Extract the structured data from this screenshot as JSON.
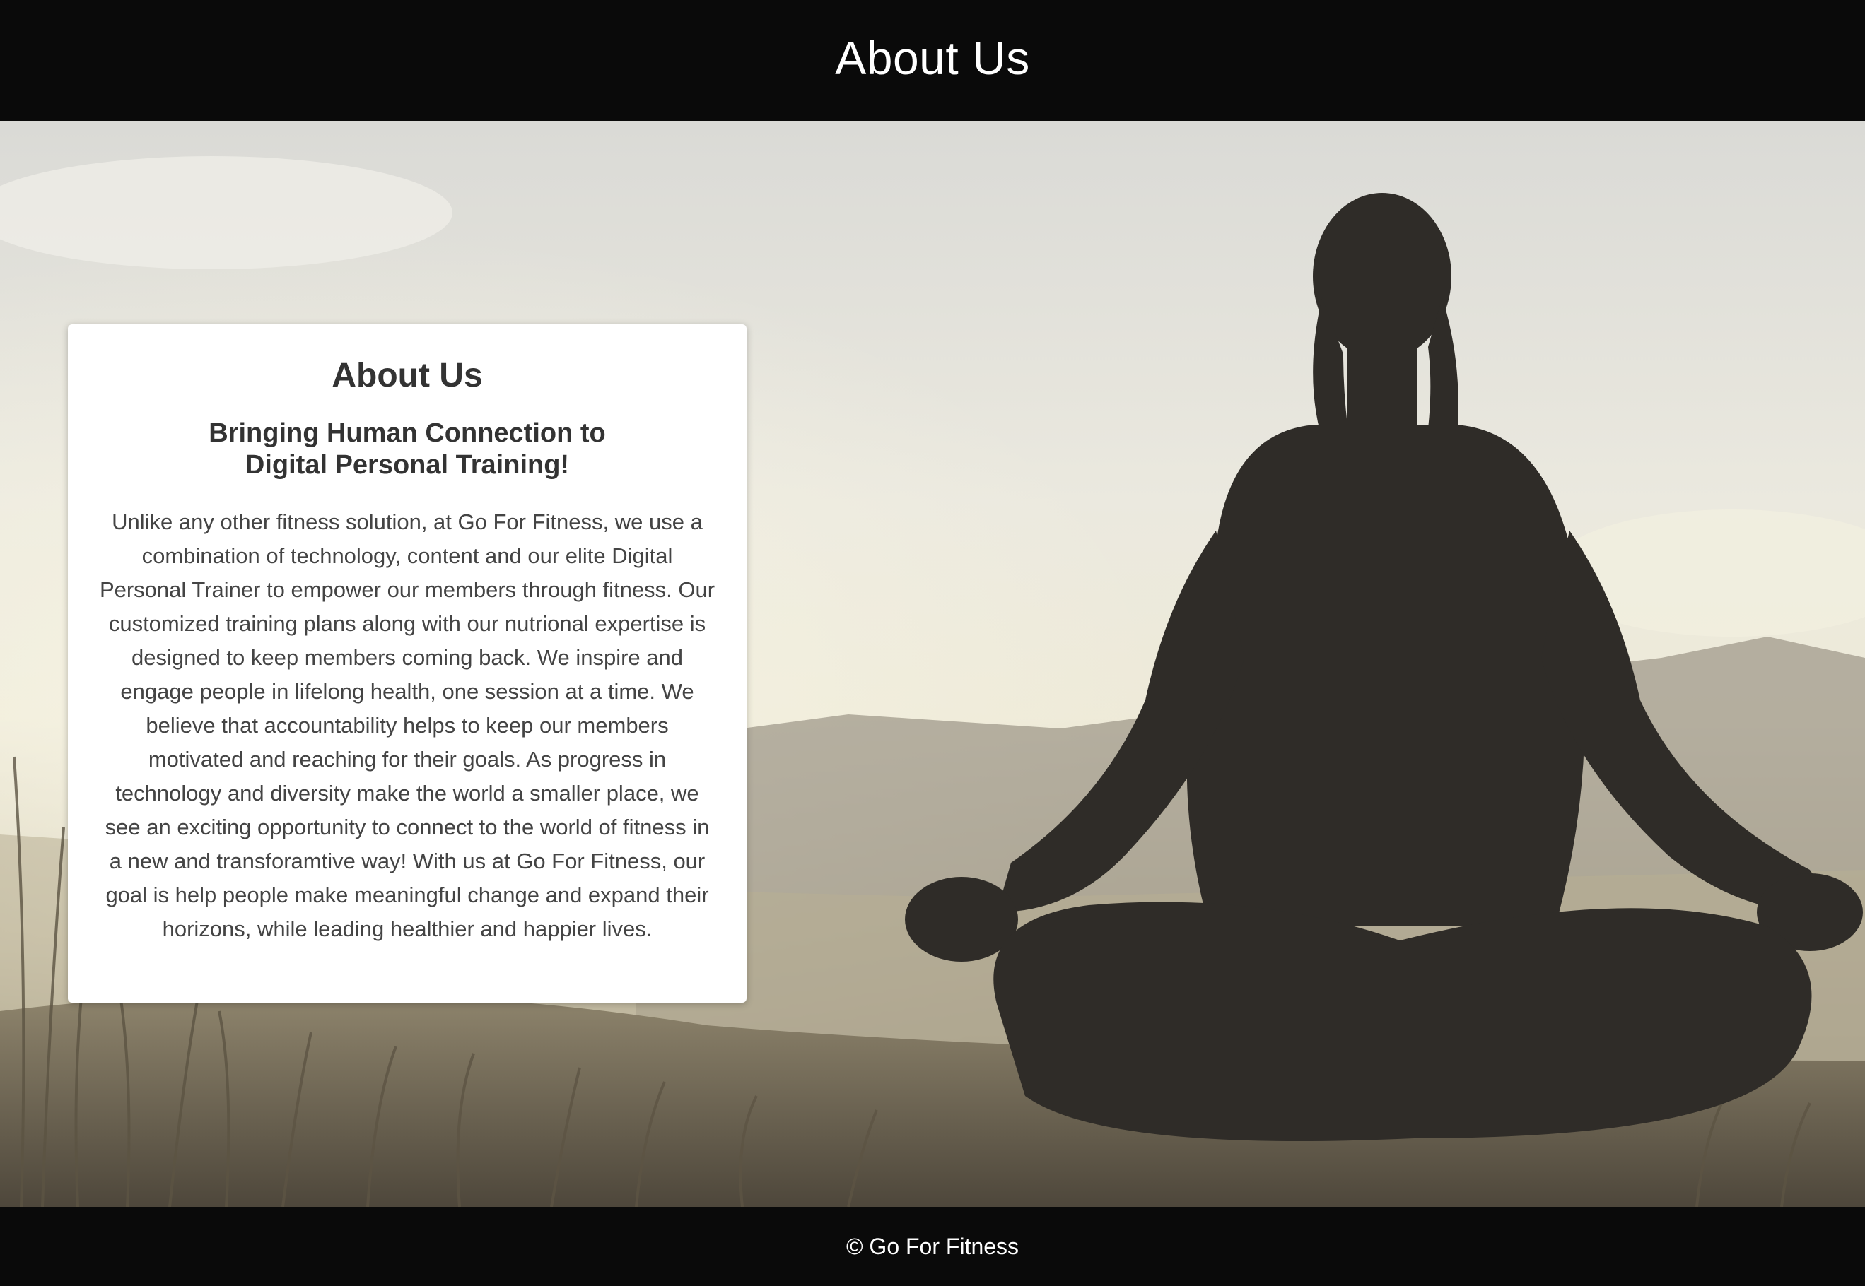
{
  "header": {
    "title": "About Us"
  },
  "hero": {
    "image": "woman-meditating-silhouette",
    "card": {
      "title": "About Us",
      "subtitle": "Bringing Human Connection to Digital Personal Training!",
      "body": "Unlike any other fitness solution, at Go For Fitness, we use a combination of technology, content and our elite Digital Personal Trainer to empower our members through fitness. Our customized training plans along with our nutrional expertise is designed to keep members coming back. We inspire and engage people in lifelong health, one session at a time. We believe that accountability helps to keep our members motivated and reaching for their goals. As progress in technology and diversity make the world a smaller place, we see an exciting opportunity to connect to the world of fitness in a new and transforamtive way! With us at Go For Fitness, our goal is help people make meaningful change and expand their horizons, while leading healthier and happier lives."
    }
  },
  "footer": {
    "copyright": "© Go For Fitness"
  },
  "colors": {
    "bar_background": "#0a0a0a",
    "card_background": "#ffffff",
    "heading_text": "#333333",
    "body_text": "#444444"
  }
}
